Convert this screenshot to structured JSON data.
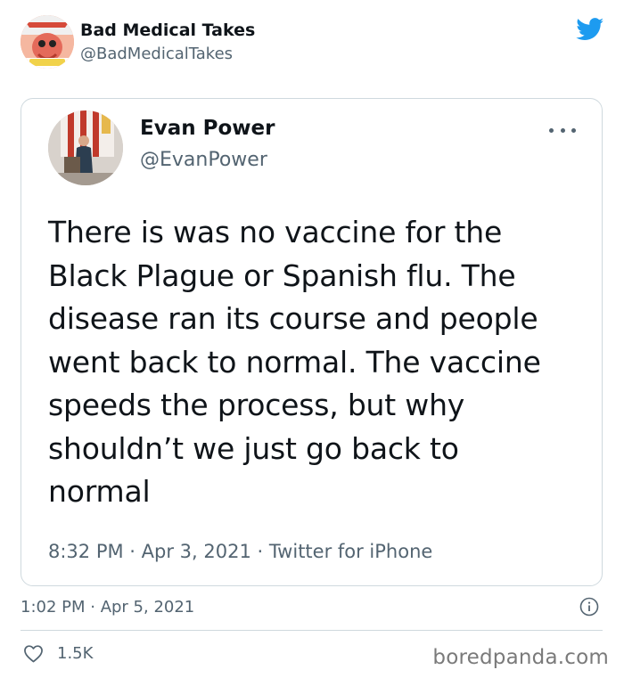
{
  "outer_tweet": {
    "author_name": "Bad Medical Takes",
    "author_handle": "@BadMedicalTakes",
    "avatar_icon": "zoidberg-avatar-icon",
    "timestamp": "1:02 PM · Apr 5, 2021",
    "like_count": "1.5K"
  },
  "quoted_tweet": {
    "author_name": "Evan Power",
    "author_handle": "@EvanPower",
    "avatar_icon": "podium-flag-avatar-icon",
    "text": "There is was no vaccine for the\nBlack Plague or Spanish flu. The\ndisease ran its course and people\nwent back to normal. The vaccine\nspeeds the process, but why\nshouldn’t we just go back to\nnormal",
    "meta": "8:32 PM · Apr 3, 2021 · Twitter for iPhone"
  },
  "watermark": "boredpanda.com",
  "colors": {
    "twitter_blue": "#1d9bf0",
    "secondary_text": "#536471",
    "border": "#cfd9de"
  }
}
